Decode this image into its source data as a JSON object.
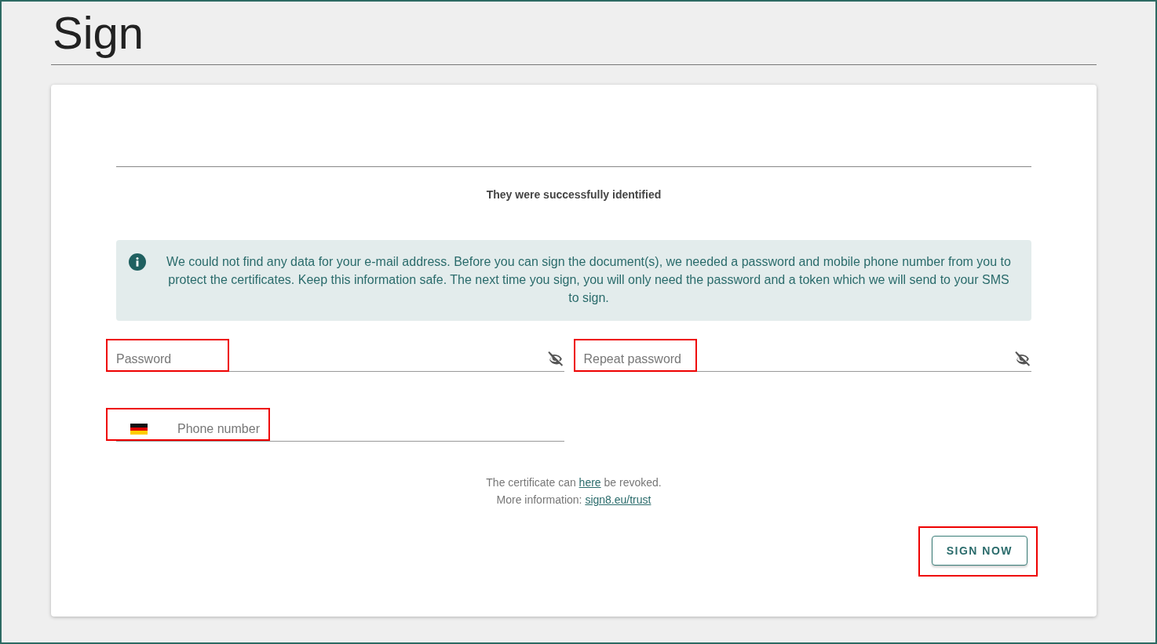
{
  "page": {
    "title": "Sign"
  },
  "status_text": "They were successfully identified",
  "info_message": "We could not find any data for your e-mail address. Before you can sign the document(s), we needed a password and mobile phone number from you to protect the certificates. Keep this information safe. The next time you sign, you will only need the password and a token which we will send to your SMS to sign.",
  "fields": [
    {
      "kind": "password",
      "placeholder": "Password",
      "highlighted": true
    },
    {
      "kind": "password",
      "placeholder": "Repeat password",
      "highlighted": true
    },
    {
      "kind": "phone",
      "placeholder": "Phone number",
      "highlighted": true
    }
  ],
  "revoke_note": {
    "before": "The certificate can",
    "link": "here",
    "after": "be revoked."
  },
  "more_info": {
    "label": "More information:",
    "link": "sign8.eu/trust"
  },
  "submit_button": {
    "label": "SIGN NOW",
    "highlighted": true
  }
}
